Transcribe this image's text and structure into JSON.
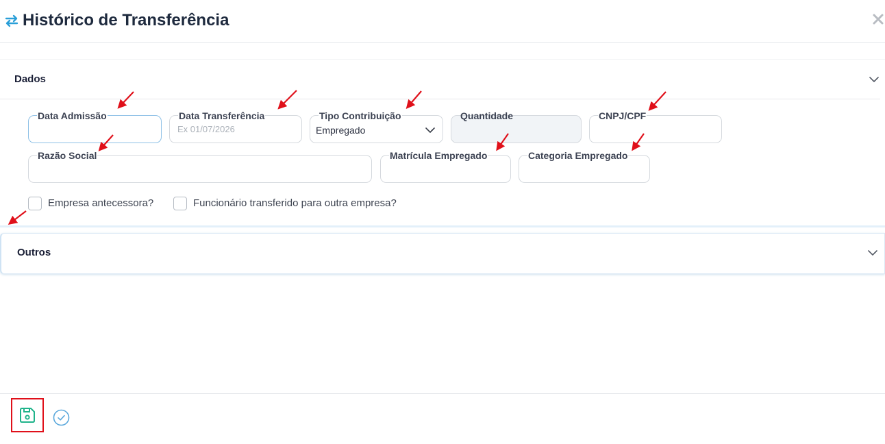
{
  "header": {
    "title": "Histórico de Transferência",
    "title_icon": "swap-arrows-icon",
    "close_icon": "close-icon"
  },
  "sections": {
    "dados": {
      "title": "Dados"
    },
    "outros": {
      "title": "Outros"
    }
  },
  "fields": {
    "data_admissao": {
      "label": "Data Admissão",
      "value": ""
    },
    "data_transferencia": {
      "label": "Data Transferência",
      "placeholder": "Ex 01/07/2026"
    },
    "tipo_contribuicao": {
      "label": "Tipo Contribuição",
      "value": "Empregado"
    },
    "quantidade": {
      "label": "Quantidade",
      "value": ""
    },
    "cnpj_cpf": {
      "label": "CNPJ/CPF",
      "value": ""
    },
    "razao_social": {
      "label": "Razão Social",
      "value": ""
    },
    "matricula_empregado": {
      "label": "Matrícula Empregado",
      "value": ""
    },
    "categoria_empregado": {
      "label": "Categoria Empregado",
      "value": ""
    }
  },
  "checkboxes": {
    "empresa_antecessora": {
      "label": "Empresa antecessora?",
      "checked": false
    },
    "funcionario_transferido": {
      "label": "Funcionário transferido para outra empresa?",
      "checked": false
    }
  },
  "footer": {
    "save_icon": "save-disk-icon",
    "confirm_icon": "check-circle-icon"
  },
  "colors": {
    "accent_blue": "#2a9fd8",
    "save_green": "#1fb38a",
    "annotation_red": "#e0101a",
    "annotation_box": "#e0101a"
  }
}
